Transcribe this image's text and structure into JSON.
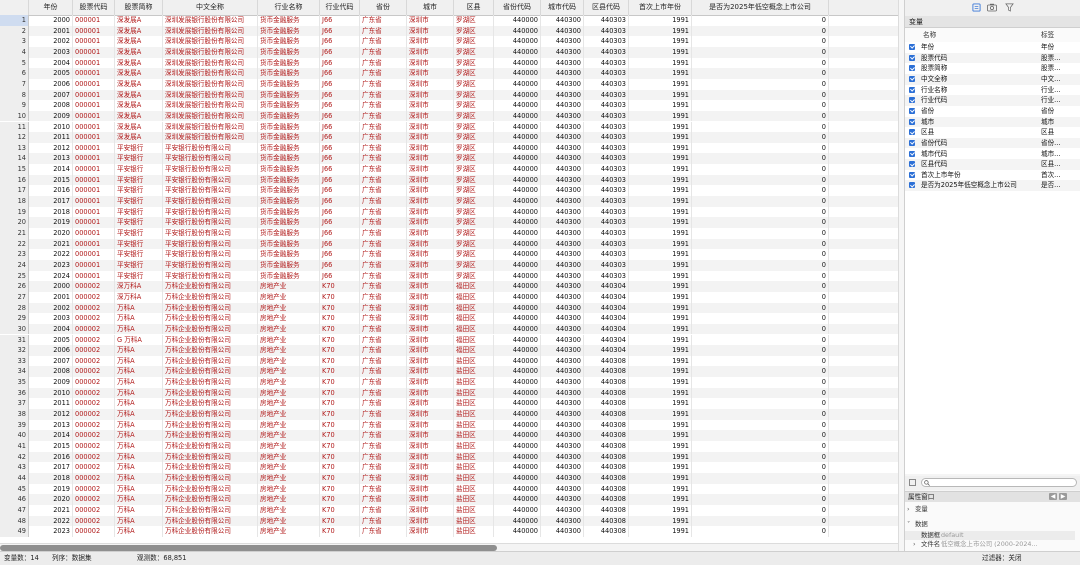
{
  "grid": {
    "columns": [
      {
        "label": "",
        "kind": "rn",
        "w": 29
      },
      {
        "label": "年份",
        "kind": "num",
        "w": 44
      },
      {
        "label": "股票代码",
        "kind": "str",
        "w": 42
      },
      {
        "label": "股票简称",
        "kind": "str",
        "w": 48
      },
      {
        "label": "中文全称",
        "kind": "str",
        "w": 95
      },
      {
        "label": "行业名称",
        "kind": "str",
        "w": 62
      },
      {
        "label": "行业代码",
        "kind": "str",
        "w": 40
      },
      {
        "label": "省份",
        "kind": "str",
        "w": 47
      },
      {
        "label": "城市",
        "kind": "str",
        "w": 47
      },
      {
        "label": "区县",
        "kind": "str",
        "w": 40
      },
      {
        "label": "省份代码",
        "kind": "num",
        "w": 47
      },
      {
        "label": "城市代码",
        "kind": "num",
        "w": 43
      },
      {
        "label": "区县代码",
        "kind": "num",
        "w": 45
      },
      {
        "label": "首次上市年份",
        "kind": "num",
        "w": 63
      },
      {
        "label": "是否为2025年低空概念上市公司",
        "kind": "num",
        "w": 137
      }
    ],
    "rows": [
      [
        "1",
        "2000",
        "000001",
        "深发展A",
        "深圳发展银行股份有限公司",
        "货币金融服务",
        "J66",
        "广东省",
        "深圳市",
        "罗湖区",
        "440000",
        "440300",
        "440303",
        "1991",
        "0"
      ],
      [
        "2",
        "2001",
        "000001",
        "深发展A",
        "深圳发展银行股份有限公司",
        "货币金融服务",
        "J66",
        "广东省",
        "深圳市",
        "罗湖区",
        "440000",
        "440300",
        "440303",
        "1991",
        "0"
      ],
      [
        "3",
        "2002",
        "000001",
        "深发展A",
        "深圳发展银行股份有限公司",
        "货币金融服务",
        "J66",
        "广东省",
        "深圳市",
        "罗湖区",
        "440000",
        "440300",
        "440303",
        "1991",
        "0"
      ],
      [
        "4",
        "2003",
        "000001",
        "深发展A",
        "深圳发展银行股份有限公司",
        "货币金融服务",
        "J66",
        "广东省",
        "深圳市",
        "罗湖区",
        "440000",
        "440300",
        "440303",
        "1991",
        "0"
      ],
      [
        "5",
        "2004",
        "000001",
        "深发展A",
        "深圳发展银行股份有限公司",
        "货币金融服务",
        "J66",
        "广东省",
        "深圳市",
        "罗湖区",
        "440000",
        "440300",
        "440303",
        "1991",
        "0"
      ],
      [
        "6",
        "2005",
        "000001",
        "深发展A",
        "深圳发展银行股份有限公司",
        "货币金融服务",
        "J66",
        "广东省",
        "深圳市",
        "罗湖区",
        "440000",
        "440300",
        "440303",
        "1991",
        "0"
      ],
      [
        "7",
        "2006",
        "000001",
        "深发展A",
        "深圳发展银行股份有限公司",
        "货币金融服务",
        "J66",
        "广东省",
        "深圳市",
        "罗湖区",
        "440000",
        "440300",
        "440303",
        "1991",
        "0"
      ],
      [
        "8",
        "2007",
        "000001",
        "深发展A",
        "深圳发展银行股份有限公司",
        "货币金融服务",
        "J66",
        "广东省",
        "深圳市",
        "罗湖区",
        "440000",
        "440300",
        "440303",
        "1991",
        "0"
      ],
      [
        "9",
        "2008",
        "000001",
        "深发展A",
        "深圳发展银行股份有限公司",
        "货币金融服务",
        "J66",
        "广东省",
        "深圳市",
        "罗湖区",
        "440000",
        "440300",
        "440303",
        "1991",
        "0"
      ],
      [
        "10",
        "2009",
        "000001",
        "深发展A",
        "深圳发展银行股份有限公司",
        "货币金融服务",
        "J66",
        "广东省",
        "深圳市",
        "罗湖区",
        "440000",
        "440300",
        "440303",
        "1991",
        "0"
      ],
      [
        "11",
        "2010",
        "000001",
        "深发展A",
        "深圳发展银行股份有限公司",
        "货币金融服务",
        "J66",
        "广东省",
        "深圳市",
        "罗湖区",
        "440000",
        "440300",
        "440303",
        "1991",
        "0"
      ],
      [
        "12",
        "2011",
        "000001",
        "深发展A",
        "深圳发展银行股份有限公司",
        "货币金融服务",
        "J66",
        "广东省",
        "深圳市",
        "罗湖区",
        "440000",
        "440300",
        "440303",
        "1991",
        "0"
      ],
      [
        "13",
        "2012",
        "000001",
        "平安银行",
        "平安银行股份有限公司",
        "货币金融服务",
        "J66",
        "广东省",
        "深圳市",
        "罗湖区",
        "440000",
        "440300",
        "440303",
        "1991",
        "0"
      ],
      [
        "14",
        "2013",
        "000001",
        "平安银行",
        "平安银行股份有限公司",
        "货币金融服务",
        "J66",
        "广东省",
        "深圳市",
        "罗湖区",
        "440000",
        "440300",
        "440303",
        "1991",
        "0"
      ],
      [
        "15",
        "2014",
        "000001",
        "平安银行",
        "平安银行股份有限公司",
        "货币金融服务",
        "J66",
        "广东省",
        "深圳市",
        "罗湖区",
        "440000",
        "440300",
        "440303",
        "1991",
        "0"
      ],
      [
        "16",
        "2015",
        "000001",
        "平安银行",
        "平安银行股份有限公司",
        "货币金融服务",
        "J66",
        "广东省",
        "深圳市",
        "罗湖区",
        "440000",
        "440300",
        "440303",
        "1991",
        "0"
      ],
      [
        "17",
        "2016",
        "000001",
        "平安银行",
        "平安银行股份有限公司",
        "货币金融服务",
        "J66",
        "广东省",
        "深圳市",
        "罗湖区",
        "440000",
        "440300",
        "440303",
        "1991",
        "0"
      ],
      [
        "18",
        "2017",
        "000001",
        "平安银行",
        "平安银行股份有限公司",
        "货币金融服务",
        "J66",
        "广东省",
        "深圳市",
        "罗湖区",
        "440000",
        "440300",
        "440303",
        "1991",
        "0"
      ],
      [
        "19",
        "2018",
        "000001",
        "平安银行",
        "平安银行股份有限公司",
        "货币金融服务",
        "J66",
        "广东省",
        "深圳市",
        "罗湖区",
        "440000",
        "440300",
        "440303",
        "1991",
        "0"
      ],
      [
        "20",
        "2019",
        "000001",
        "平安银行",
        "平安银行股份有限公司",
        "货币金融服务",
        "J66",
        "广东省",
        "深圳市",
        "罗湖区",
        "440000",
        "440300",
        "440303",
        "1991",
        "0"
      ],
      [
        "21",
        "2020",
        "000001",
        "平安银行",
        "平安银行股份有限公司",
        "货币金融服务",
        "J66",
        "广东省",
        "深圳市",
        "罗湖区",
        "440000",
        "440300",
        "440303",
        "1991",
        "0"
      ],
      [
        "22",
        "2021",
        "000001",
        "平安银行",
        "平安银行股份有限公司",
        "货币金融服务",
        "J66",
        "广东省",
        "深圳市",
        "罗湖区",
        "440000",
        "440300",
        "440303",
        "1991",
        "0"
      ],
      [
        "23",
        "2022",
        "000001",
        "平安银行",
        "平安银行股份有限公司",
        "货币金融服务",
        "J66",
        "广东省",
        "深圳市",
        "罗湖区",
        "440000",
        "440300",
        "440303",
        "1991",
        "0"
      ],
      [
        "24",
        "2023",
        "000001",
        "平安银行",
        "平安银行股份有限公司",
        "货币金融服务",
        "J66",
        "广东省",
        "深圳市",
        "罗湖区",
        "440000",
        "440300",
        "440303",
        "1991",
        "0"
      ],
      [
        "25",
        "2024",
        "000001",
        "平安银行",
        "平安银行股份有限公司",
        "货币金融服务",
        "J66",
        "广东省",
        "深圳市",
        "罗湖区",
        "440000",
        "440300",
        "440303",
        "1991",
        "0"
      ],
      [
        "26",
        "2000",
        "000002",
        "深万科A",
        "万科企业股份有限公司",
        "房地产业",
        "K70",
        "广东省",
        "深圳市",
        "福田区",
        "440000",
        "440300",
        "440304",
        "1991",
        "0"
      ],
      [
        "27",
        "2001",
        "000002",
        "深万科A",
        "万科企业股份有限公司",
        "房地产业",
        "K70",
        "广东省",
        "深圳市",
        "福田区",
        "440000",
        "440300",
        "440304",
        "1991",
        "0"
      ],
      [
        "28",
        "2002",
        "000002",
        "万科A",
        "万科企业股份有限公司",
        "房地产业",
        "K70",
        "广东省",
        "深圳市",
        "福田区",
        "440000",
        "440300",
        "440304",
        "1991",
        "0"
      ],
      [
        "29",
        "2003",
        "000002",
        "万科A",
        "万科企业股份有限公司",
        "房地产业",
        "K70",
        "广东省",
        "深圳市",
        "福田区",
        "440000",
        "440300",
        "440304",
        "1991",
        "0"
      ],
      [
        "30",
        "2004",
        "000002",
        "万科A",
        "万科企业股份有限公司",
        "房地产业",
        "K70",
        "广东省",
        "深圳市",
        "福田区",
        "440000",
        "440300",
        "440304",
        "1991",
        "0"
      ],
      [
        "31",
        "2005",
        "000002",
        "G 万科A",
        "万科企业股份有限公司",
        "房地产业",
        "K70",
        "广东省",
        "深圳市",
        "福田区",
        "440000",
        "440300",
        "440304",
        "1991",
        "0"
      ],
      [
        "32",
        "2006",
        "000002",
        "万科A",
        "万科企业股份有限公司",
        "房地产业",
        "K70",
        "广东省",
        "深圳市",
        "福田区",
        "440000",
        "440300",
        "440304",
        "1991",
        "0"
      ],
      [
        "33",
        "2007",
        "000002",
        "万科A",
        "万科企业股份有限公司",
        "房地产业",
        "K70",
        "广东省",
        "深圳市",
        "盐田区",
        "440000",
        "440300",
        "440308",
        "1991",
        "0"
      ],
      [
        "34",
        "2008",
        "000002",
        "万科A",
        "万科企业股份有限公司",
        "房地产业",
        "K70",
        "广东省",
        "深圳市",
        "盐田区",
        "440000",
        "440300",
        "440308",
        "1991",
        "0"
      ],
      [
        "35",
        "2009",
        "000002",
        "万科A",
        "万科企业股份有限公司",
        "房地产业",
        "K70",
        "广东省",
        "深圳市",
        "盐田区",
        "440000",
        "440300",
        "440308",
        "1991",
        "0"
      ],
      [
        "36",
        "2010",
        "000002",
        "万科A",
        "万科企业股份有限公司",
        "房地产业",
        "K70",
        "广东省",
        "深圳市",
        "盐田区",
        "440000",
        "440300",
        "440308",
        "1991",
        "0"
      ],
      [
        "37",
        "2011",
        "000002",
        "万科A",
        "万科企业股份有限公司",
        "房地产业",
        "K70",
        "广东省",
        "深圳市",
        "盐田区",
        "440000",
        "440300",
        "440308",
        "1991",
        "0"
      ],
      [
        "38",
        "2012",
        "000002",
        "万科A",
        "万科企业股份有限公司",
        "房地产业",
        "K70",
        "广东省",
        "深圳市",
        "盐田区",
        "440000",
        "440300",
        "440308",
        "1991",
        "0"
      ],
      [
        "39",
        "2013",
        "000002",
        "万科A",
        "万科企业股份有限公司",
        "房地产业",
        "K70",
        "广东省",
        "深圳市",
        "盐田区",
        "440000",
        "440300",
        "440308",
        "1991",
        "0"
      ],
      [
        "40",
        "2014",
        "000002",
        "万科A",
        "万科企业股份有限公司",
        "房地产业",
        "K70",
        "广东省",
        "深圳市",
        "盐田区",
        "440000",
        "440300",
        "440308",
        "1991",
        "0"
      ],
      [
        "41",
        "2015",
        "000002",
        "万科A",
        "万科企业股份有限公司",
        "房地产业",
        "K70",
        "广东省",
        "深圳市",
        "盐田区",
        "440000",
        "440300",
        "440308",
        "1991",
        "0"
      ],
      [
        "42",
        "2016",
        "000002",
        "万科A",
        "万科企业股份有限公司",
        "房地产业",
        "K70",
        "广东省",
        "深圳市",
        "盐田区",
        "440000",
        "440300",
        "440308",
        "1991",
        "0"
      ],
      [
        "43",
        "2017",
        "000002",
        "万科A",
        "万科企业股份有限公司",
        "房地产业",
        "K70",
        "广东省",
        "深圳市",
        "盐田区",
        "440000",
        "440300",
        "440308",
        "1991",
        "0"
      ],
      [
        "44",
        "2018",
        "000002",
        "万科A",
        "万科企业股份有限公司",
        "房地产业",
        "K70",
        "广东省",
        "深圳市",
        "盐田区",
        "440000",
        "440300",
        "440308",
        "1991",
        "0"
      ],
      [
        "45",
        "2019",
        "000002",
        "万科A",
        "万科企业股份有限公司",
        "房地产业",
        "K70",
        "广东省",
        "深圳市",
        "盐田区",
        "440000",
        "440300",
        "440308",
        "1991",
        "0"
      ],
      [
        "46",
        "2020",
        "000002",
        "万科A",
        "万科企业股份有限公司",
        "房地产业",
        "K70",
        "广东省",
        "深圳市",
        "盐田区",
        "440000",
        "440300",
        "440308",
        "1991",
        "0"
      ],
      [
        "47",
        "2021",
        "000002",
        "万科A",
        "万科企业股份有限公司",
        "房地产业",
        "K70",
        "广东省",
        "深圳市",
        "盐田区",
        "440000",
        "440300",
        "440308",
        "1991",
        "0"
      ],
      [
        "48",
        "2022",
        "000002",
        "万科A",
        "万科企业股份有限公司",
        "房地产业",
        "K70",
        "广东省",
        "深圳市",
        "盐田区",
        "440000",
        "440300",
        "440308",
        "1991",
        "0"
      ],
      [
        "49",
        "2023",
        "000002",
        "万科A",
        "万科企业股份有限公司",
        "房地产业",
        "K70",
        "广东省",
        "深圳市",
        "盐田区",
        "440000",
        "440300",
        "440308",
        "1991",
        "0"
      ]
    ]
  },
  "variables_panel": {
    "title": "变量",
    "col_name": "名称",
    "col_label": "标签",
    "items": [
      {
        "name": "年份",
        "label": "年份"
      },
      {
        "name": "股票代码",
        "label": "股票..."
      },
      {
        "name": "股票简称",
        "label": "股票..."
      },
      {
        "name": "中文全称",
        "label": "中文..."
      },
      {
        "name": "行业名称",
        "label": "行业..."
      },
      {
        "name": "行业代码",
        "label": "行业..."
      },
      {
        "name": "省份",
        "label": "省份"
      },
      {
        "name": "城市",
        "label": "城市"
      },
      {
        "name": "区县",
        "label": "区县"
      },
      {
        "name": "省份代码",
        "label": "省份..."
      },
      {
        "name": "城市代码",
        "label": "城市..."
      },
      {
        "name": "区县代码",
        "label": "区县..."
      },
      {
        "name": "首次上市年份",
        "label": "首次..."
      },
      {
        "name": "是否为2025年低空概念上市公司",
        "label": "是否..."
      }
    ]
  },
  "properties_panel": {
    "title": "属性窗口",
    "section_vars": "变量",
    "section_data": "数据",
    "rows": [
      {
        "key": "数据框",
        "value": "default"
      },
      {
        "key": "文件名",
        "value": "低空概念上市公司 (2000-2024..."
      }
    ]
  },
  "toolbar": {
    "icons": [
      "notes-icon",
      "camera-icon",
      "filter-icon"
    ]
  },
  "status": {
    "vars": "变量数：14",
    "order": "列序：数据集",
    "obs": "观测数：68,851",
    "filter": "过滤器：关闭"
  },
  "colors": {
    "string_text": "#b01818",
    "checkbox": "#2b6fd6"
  }
}
